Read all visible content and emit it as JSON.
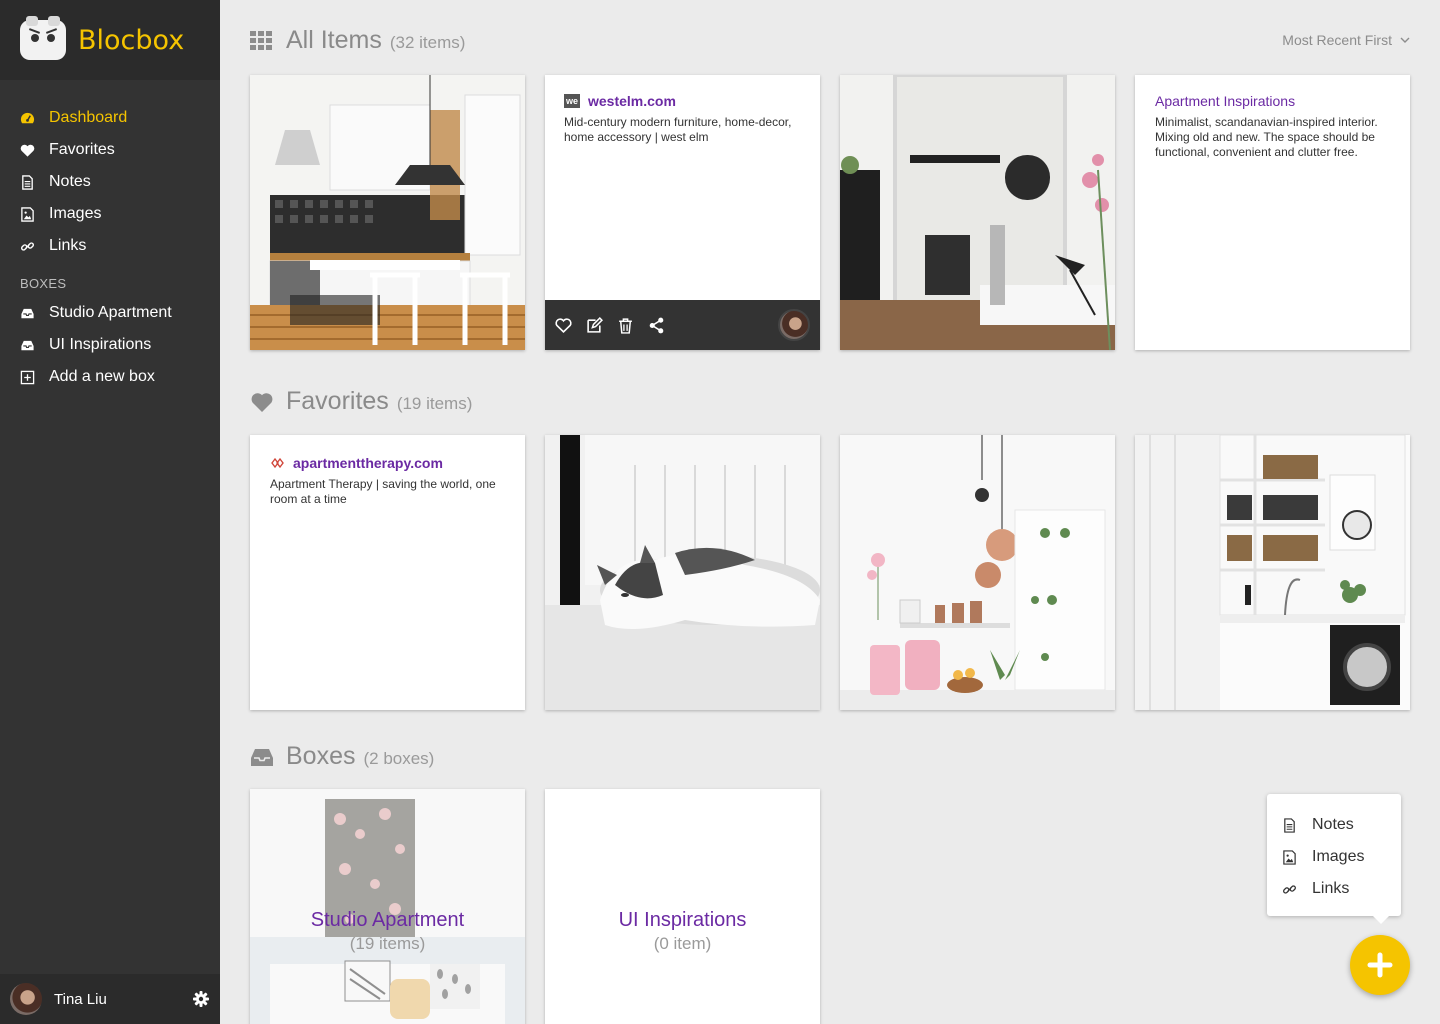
{
  "app": {
    "brand": "Blocbox"
  },
  "sidebar": {
    "nav": [
      {
        "label": "Dashboard",
        "icon": "dashboard-icon",
        "active": true
      },
      {
        "label": "Favorites",
        "icon": "heart-icon"
      },
      {
        "label": "Notes",
        "icon": "note-icon"
      },
      {
        "label": "Images",
        "icon": "image-icon"
      },
      {
        "label": "Links",
        "icon": "link-icon"
      }
    ],
    "boxes_label": "BOXES",
    "boxes": [
      {
        "label": "Studio Apartment",
        "icon": "inbox-icon"
      },
      {
        "label": "UI Inspirations",
        "icon": "inbox-icon"
      },
      {
        "label": "Add a new box",
        "icon": "add-box-icon"
      }
    ],
    "user": {
      "name": "Tina Liu"
    }
  },
  "sections": {
    "all_items": {
      "title": "All Items",
      "count": "(32 items)"
    },
    "favorites": {
      "title": "Favorites",
      "count": "(19 items)"
    },
    "boxes": {
      "title": "Boxes",
      "count": "(2 boxes)"
    }
  },
  "sort": {
    "label": "Most Recent First"
  },
  "cards": {
    "westelm": {
      "favicon": "we",
      "title": "westelm.com",
      "desc": "Mid-century modern furniture, home-decor, home accessory | west elm"
    },
    "note": {
      "title": "Apartment Inspirations",
      "desc": "Minimalist, scandanavian-inspired interior. Mixing old and new. The space should be functional, convenient and clutter free."
    },
    "apt_therapy": {
      "title": "apartmenttherapy.com",
      "desc": "Apartment Therapy | saving the world, one room at a time"
    }
  },
  "box_cards": [
    {
      "title": "Studio Apartment",
      "count": "(19 items)"
    },
    {
      "title": "UI Inspirations",
      "count": "(0 item)"
    }
  ],
  "add_menu": [
    "Notes",
    "Images",
    "Links"
  ],
  "colors": {
    "accent": "#f5c400",
    "link": "#6b2aa3",
    "sidebar": "#333333",
    "background": "#ebebeb"
  }
}
